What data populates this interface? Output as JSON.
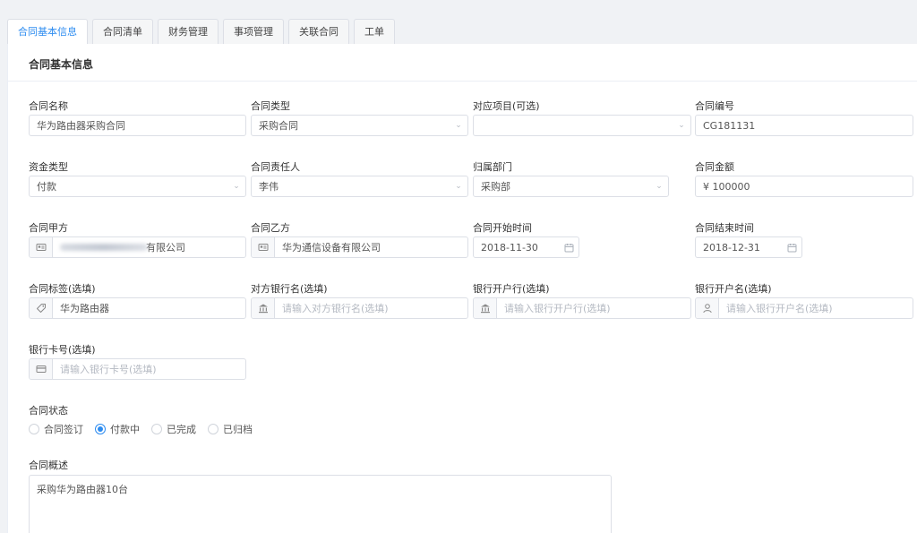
{
  "tabs": [
    {
      "label": "合同基本信息",
      "active": true
    },
    {
      "label": "合同清单",
      "active": false
    },
    {
      "label": "财务管理",
      "active": false
    },
    {
      "label": "事项管理",
      "active": false
    },
    {
      "label": "关联合同",
      "active": false
    },
    {
      "label": "工单",
      "active": false
    }
  ],
  "panel": {
    "title": "合同基本信息"
  },
  "fields": {
    "contract_name": {
      "label": "合同名称",
      "value": "华为路由器采购合同"
    },
    "contract_type": {
      "label": "合同类型",
      "value": "采购合同"
    },
    "project": {
      "label": "对应项目(可选)",
      "value": ""
    },
    "contract_no": {
      "label": "合同编号",
      "value": "CG181131"
    },
    "fund_type": {
      "label": "资金类型",
      "value": "付款"
    },
    "owner": {
      "label": "合同责任人",
      "value": "李伟"
    },
    "department": {
      "label": "归属部门",
      "value": "采购部"
    },
    "amount": {
      "label": "合同金额",
      "value": "¥ 100000"
    },
    "party_a": {
      "label": "合同甲方",
      "value_suffix": "有限公司"
    },
    "party_b": {
      "label": "合同乙方",
      "value": "华为通信设备有限公司"
    },
    "start_date": {
      "label": "合同开始时间",
      "value": "2018-11-30"
    },
    "end_date": {
      "label": "合同结束时间",
      "value": "2018-12-31"
    },
    "tag": {
      "label": "合同标签(选填)",
      "value": "华为路由器"
    },
    "bank_name": {
      "label": "对方银行名(选填)",
      "placeholder": "请输入对方银行名(选填)"
    },
    "bank_branch": {
      "label": "银行开户行(选填)",
      "placeholder": "请输入银行开户行(选填)"
    },
    "account_name": {
      "label": "银行开户名(选填)",
      "placeholder": "请输入银行开户名(选填)"
    },
    "card_no": {
      "label": "银行卡号(选填)",
      "placeholder": "请输入银行卡号(选填)"
    }
  },
  "status": {
    "label": "合同状态",
    "options": [
      "合同签订",
      "付款中",
      "已完成",
      "已归档"
    ],
    "selected": "付款中"
  },
  "summary": {
    "label": "合同概述",
    "value": "采购华为路由器10台"
  },
  "colors": {
    "accent": "#2d8cf0",
    "border": "#dcdfe6",
    "background": "#f0f2f5"
  }
}
